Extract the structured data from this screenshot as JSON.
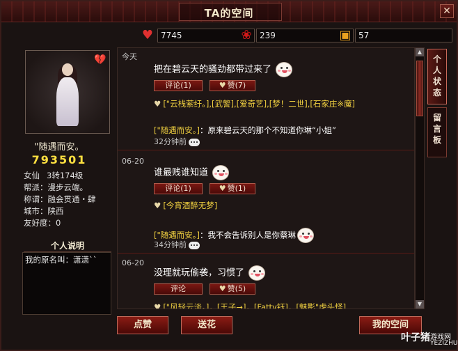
{
  "window": {
    "title": "TA的空间",
    "close_label": "✕"
  },
  "stats": {
    "hearts": {
      "icon": "heart-icon",
      "value": "7745"
    },
    "roses": {
      "icon": "rose-icon",
      "value": "239"
    },
    "gifts": {
      "icon": "gift-icon",
      "value": "57"
    }
  },
  "profile": {
    "motto": "\"随遇而安。",
    "score": "793501",
    "gender_class": "女仙",
    "level": "3转174级",
    "guild_label": "帮派：漫步云端。",
    "title_label": "称谓：融会贯通・肆",
    "city_label": "城市：陕西",
    "friendship_label": "友好度：0",
    "description_header": "个人说明",
    "description": "我的原名叫：潇潇``"
  },
  "feed": {
    "posts": [
      {
        "date": "今天",
        "text": "把在碧云天的骚劲都带过来了",
        "comment_label": "评论(1)",
        "like_label": "赞(7)",
        "likers": "[\"云栈萦纡。],[武警],[爱奇艺],[梦！二世],[石家庄※魔]",
        "reply_author": "[\"随遇而安。]",
        "reply_text": "：原来碧云天的那个不知道你琳“小姐”",
        "reply_time": "32分钟前"
      },
      {
        "date": "06-20",
        "text": "谁最贱谁知道",
        "comment_label": "评论(1)",
        "like_label": "赞(1)",
        "likers": "[今宵酒醉无梦]",
        "reply_author": "[\"随遇而安。]",
        "reply_text": "：我不会告诉别人是你蔡琳",
        "reply_time": "34分钟前"
      },
      {
        "date": "06-20",
        "text": "没理就玩偷袭，习惯了",
        "comment_label": "评论",
        "like_label": "赞(5)",
        "likers": "[\"风轻云淡。]，[王子→]，[Fatty钰]，[魅影\"虎头怪]"
      }
    ]
  },
  "tabs": {
    "status": "个人状态",
    "guestbook": "留言板"
  },
  "buttons": {
    "praise": "点赞",
    "flower": "送花",
    "my_space": "我的空间"
  },
  "watermark": {
    "brand": "叶子猪",
    "sub": "游戏网",
    "url": "YEZIZHU.COM"
  }
}
